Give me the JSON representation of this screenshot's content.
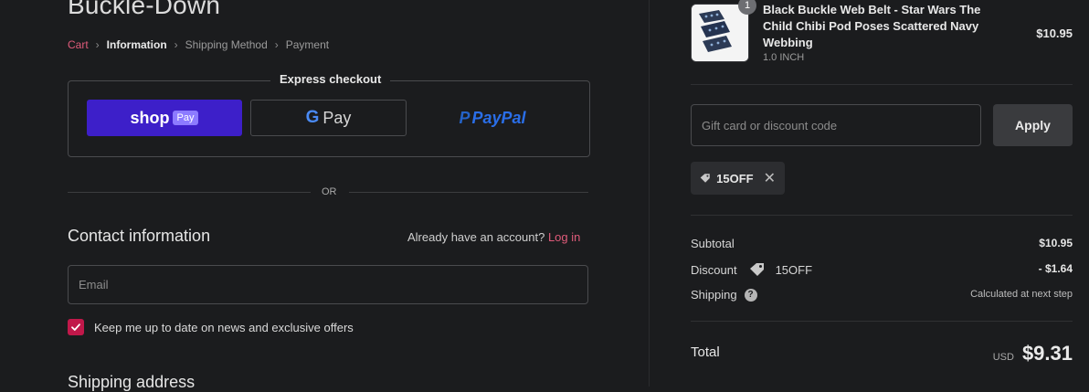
{
  "store": {
    "title": "Buckle-Down"
  },
  "breadcrumb": {
    "items": [
      "Cart",
      "Information",
      "Shipping Method",
      "Payment"
    ]
  },
  "express": {
    "title": "Express checkout",
    "shop_word": "shop",
    "shop_pill": "Pay",
    "gpay_g": "G",
    "gpay_text": "Pay",
    "paypal_mark": "P",
    "paypal_text": "PayPal"
  },
  "divider": {
    "or": "OR"
  },
  "contact": {
    "heading": "Contact information",
    "account_prompt": "Already have an account?",
    "login_label": "Log in",
    "email_placeholder": "Email",
    "email_value": "",
    "newsletter_label": "Keep me up to date on news and exclusive offers",
    "newsletter_checked": true
  },
  "shipping": {
    "heading": "Shipping address"
  },
  "cart_item": {
    "quantity": "1",
    "name": "Black Buckle Web Belt - Star Wars The Child Chibi Pod Poses Scattered Navy Webbing",
    "variant": "1.0 INCH",
    "price": "$10.95"
  },
  "discount_form": {
    "placeholder": "Gift card or discount code",
    "value": "",
    "apply_label": "Apply"
  },
  "applied_discount": {
    "code": "15OFF",
    "remove_icon": "close-icon"
  },
  "summary": {
    "subtotal_label": "Subtotal",
    "subtotal_value": "$10.95",
    "discount_label": "Discount",
    "discount_code": "15OFF",
    "discount_value": "- $1.64",
    "shipping_label": "Shipping",
    "shipping_help": "?",
    "shipping_value": "Calculated at next step",
    "total_label": "Total",
    "currency": "USD",
    "total_value": "$9.31"
  },
  "colors": {
    "background": "#1b1c1e",
    "accent": "#e05b7a",
    "checkbox": "#c1184a",
    "shop_pay": "#3d1fc9",
    "paypal": "#2a6ee8"
  }
}
